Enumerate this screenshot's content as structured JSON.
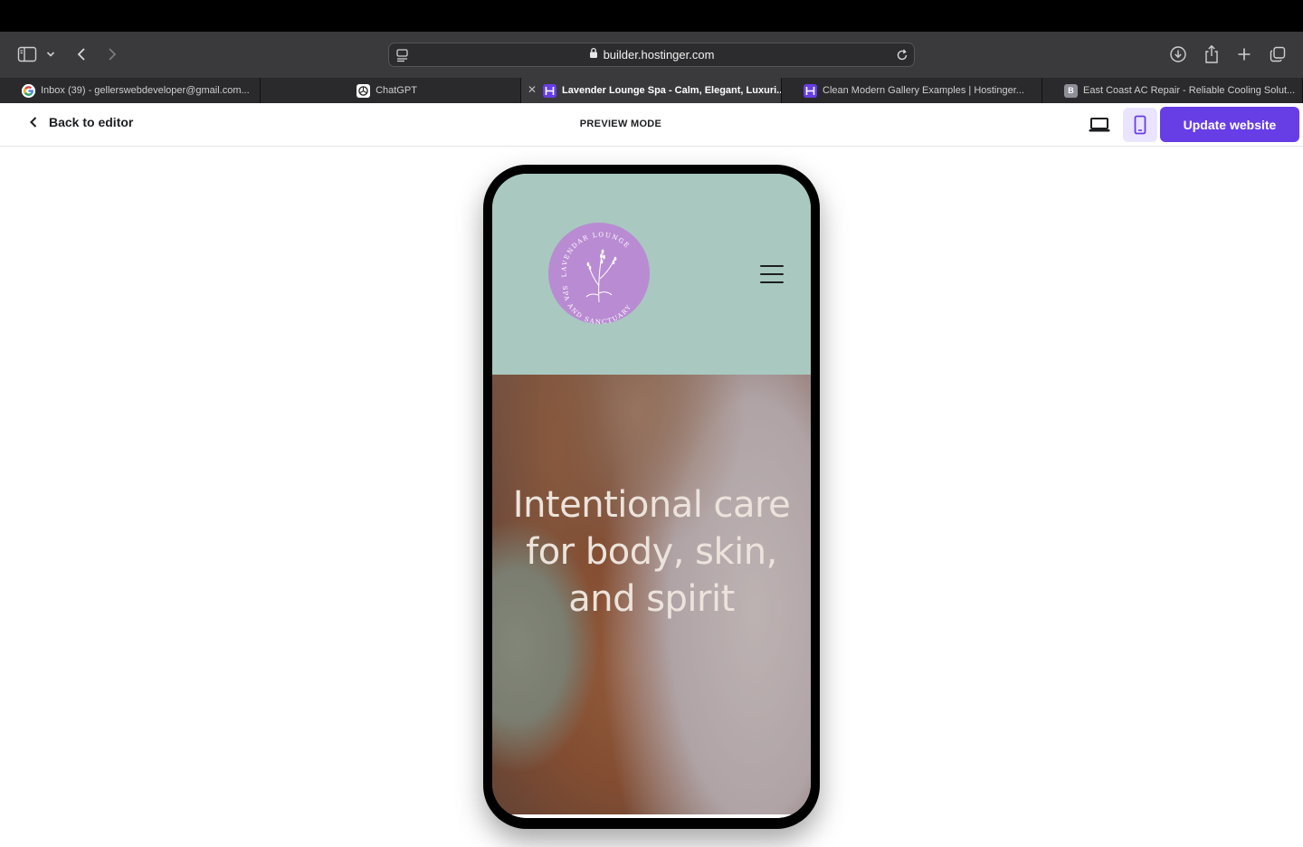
{
  "browser": {
    "url": "builder.hostinger.com",
    "tabs": [
      {
        "title": "Inbox (39) - gellerswebdeveloper@gmail.com...",
        "favicon": "google-icon",
        "active": false
      },
      {
        "title": "ChatGPT",
        "favicon": "chatgpt-icon",
        "active": false
      },
      {
        "title": "Lavender Lounge Spa - Calm, Elegant, Luxuri...",
        "favicon": "hostinger-icon",
        "active": true
      },
      {
        "title": "Clean Modern Gallery Examples | Hostinger...",
        "favicon": "hostinger-icon",
        "active": false
      },
      {
        "title": "East Coast AC Repair - Reliable Cooling Solut...",
        "favicon": "b-letter-icon",
        "favicon_letter": "B",
        "active": false
      }
    ]
  },
  "editor": {
    "back_label": "Back to editor",
    "mode_label": "PREVIEW MODE",
    "update_label": "Update website",
    "active_device": "mobile"
  },
  "site": {
    "logo": {
      "top_text": "LAVENDAR LOUNGE",
      "bottom_text": "SPA AND SANCTUARY"
    },
    "hero_title": "Intentional care for body, skin, and spirit"
  },
  "colors": {
    "brand_purple": "#673de6",
    "header_teal": "#a9c8c0",
    "logo_lavender": "#b98bd3"
  }
}
